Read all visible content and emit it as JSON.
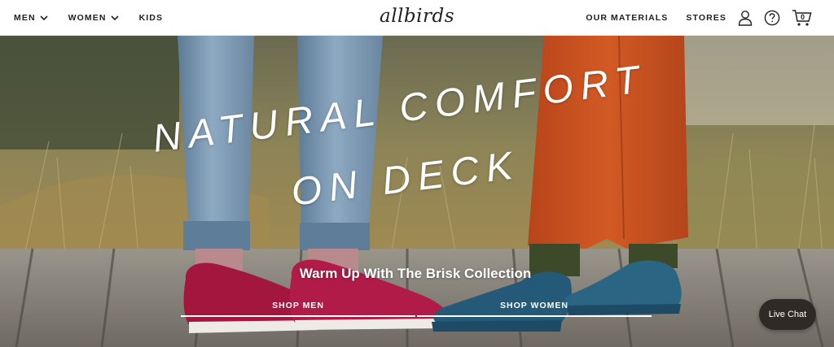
{
  "header": {
    "nav_left": {
      "men": "MEN",
      "women": "WOMEN",
      "kids": "KIDS"
    },
    "logo_text": "allbirds",
    "nav_right": {
      "materials": "OUR MATERIALS",
      "stores": "STORES"
    },
    "icons": {
      "account": "user-icon",
      "help": "question-circle-icon",
      "cart": "cart-icon"
    },
    "cart_count": "0"
  },
  "hero": {
    "headline_line1": "NATURAL COMFORT",
    "headline_line2": "ON DECK",
    "subhead": "Warm Up With The Brisk Collection",
    "shop_men": "SHOP MEN",
    "shop_women": "SHOP WOMEN"
  },
  "live_chat": "Live Chat",
  "colors": {
    "text": "#212121",
    "jeans": "#7f9db8",
    "orange_pants": "#c8501f",
    "red_shoe": "#a3163e",
    "blue_shoe": "#245a78",
    "deck": "#8c8a84",
    "chat_bg": "#2f2a26"
  }
}
